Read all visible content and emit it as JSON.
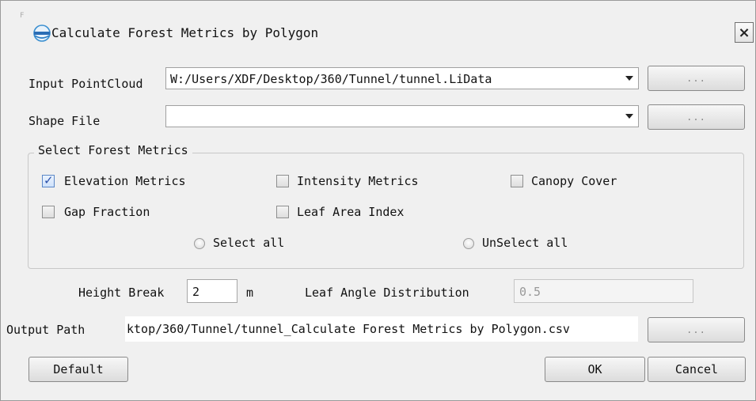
{
  "window": {
    "title": "Calculate Forest Metrics by Polygon",
    "close_label": "×",
    "corner_mark": "F"
  },
  "input_pointcloud": {
    "label": "Input PointCloud",
    "value": "W:/Users/XDF/Desktop/360/Tunnel/tunnel.LiData",
    "browse_label": "..."
  },
  "shape_file": {
    "label": "Shape File",
    "value": "",
    "browse_label": "..."
  },
  "metrics_group": {
    "title": "Select Forest Metrics",
    "options": [
      {
        "label": "Elevation Metrics",
        "checked": true
      },
      {
        "label": "Intensity Metrics",
        "checked": false
      },
      {
        "label": "Canopy Cover",
        "checked": false
      },
      {
        "label": "Gap Fraction",
        "checked": false
      },
      {
        "label": "Leaf Area Index",
        "checked": false
      }
    ],
    "select_all_label": "Select all",
    "unselect_all_label": "UnSelect all"
  },
  "height_break": {
    "label": "Height Break",
    "value": "2",
    "unit": "m"
  },
  "leaf_angle": {
    "label": "Leaf Angle Distribution",
    "value": "0.5"
  },
  "output_path": {
    "label": "Output Path",
    "value": "ktop/360/Tunnel/tunnel_Calculate Forest Metrics by Polygon.csv",
    "browse_label": "..."
  },
  "buttons": {
    "default_label": "Default",
    "ok_label": "OK",
    "cancel_label": "Cancel"
  }
}
